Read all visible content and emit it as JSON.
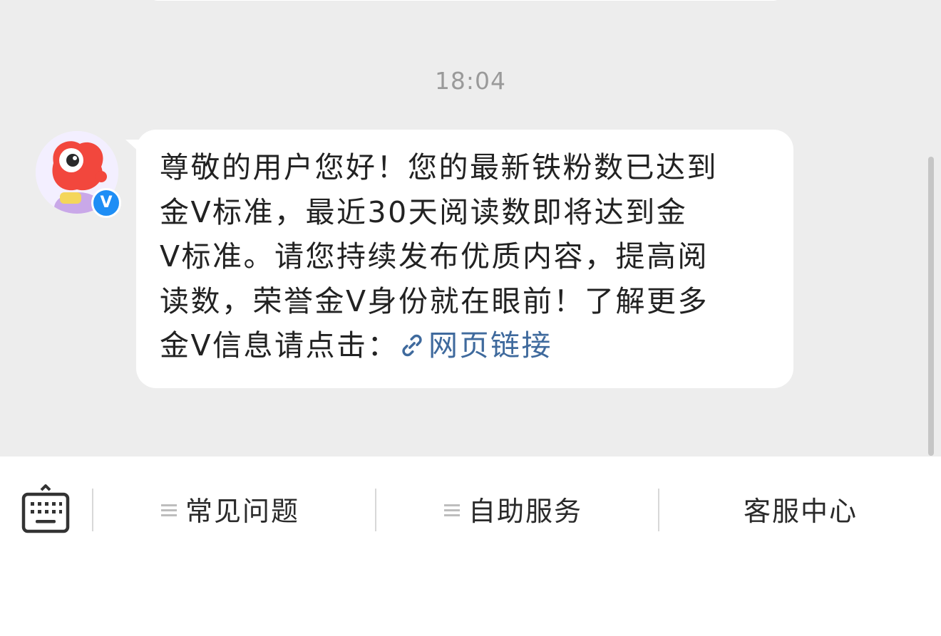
{
  "timestamp": "18:04",
  "message": {
    "lines": [
      "尊敬的用户您好！您的最新铁粉数已达到",
      "金Ⅴ标准，最近30天阅读数即将达到金",
      "Ⅴ标准。请您持续发布优质内容，提高阅",
      "读数，荣誉金Ⅴ身份就在眼前！了解更多"
    ],
    "last_line_prefix": "金Ⅴ信息请点击：",
    "link_text": "网页链接"
  },
  "avatar": {
    "badge": "V"
  },
  "bottom_menu": {
    "items": [
      "常见问题",
      "自助服务",
      "客服中心"
    ]
  },
  "icons": [
    "keyboard-icon",
    "link-icon",
    "menu-list-icon",
    "verified-badge-icon"
  ],
  "colors": {
    "chat_background": "#ededed",
    "bubble": "#ffffff",
    "link": "#3f6a9d",
    "badge": "#1e8ef5"
  }
}
